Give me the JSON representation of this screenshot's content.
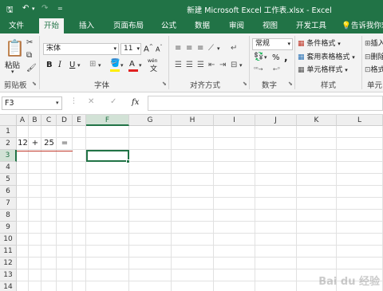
{
  "title": "新建 Microsoft Excel 工作表.xlsx - Excel",
  "colors": {
    "accent": "#217346",
    "underline_red": "#c0392b"
  },
  "quick_access": [
    "save-icon",
    "undo-icon",
    "redo-icon"
  ],
  "tabs": [
    "文件",
    "开始",
    "插入",
    "页面布局",
    "公式",
    "数据",
    "审阅",
    "视图",
    "开发工具"
  ],
  "tell_me": "告诉我你想",
  "ribbon": {
    "clipboard": {
      "paste": "粘贴",
      "label": "剪贴板"
    },
    "font": {
      "name": "宋体",
      "size": "11",
      "bold": "B",
      "italic": "I",
      "underline": "U",
      "grow": "A",
      "shrink": "A",
      "wen": "wén",
      "label": "字体"
    },
    "align": {
      "label": "对齐方式"
    },
    "number": {
      "format": "常规",
      "percent": "%",
      "comma": ",",
      "label": "数字"
    },
    "styles": {
      "cond": "条件格式",
      "table": "套用表格格式",
      "cell": "单元格样式",
      "label": "样式"
    },
    "cells": {
      "insert": "插入",
      "delete": "删除",
      "format": "格式",
      "label": "单元"
    }
  },
  "formula_bar": {
    "name_box": "F3",
    "fx": "fx",
    "value": ""
  },
  "columns": [
    "A",
    "B",
    "C",
    "D",
    "E",
    "F",
    "G",
    "H",
    "I",
    "J",
    "K",
    "L"
  ],
  "rows": [
    "1",
    "2",
    "3",
    "4",
    "5",
    "6",
    "7",
    "8",
    "9",
    "10",
    "11",
    "12",
    "13",
    "14",
    "15"
  ],
  "cells": {
    "A2": "12",
    "B2": "+",
    "C2": "25",
    "D2": "="
  },
  "selected": "F3",
  "watermark": "Bai du 经验"
}
